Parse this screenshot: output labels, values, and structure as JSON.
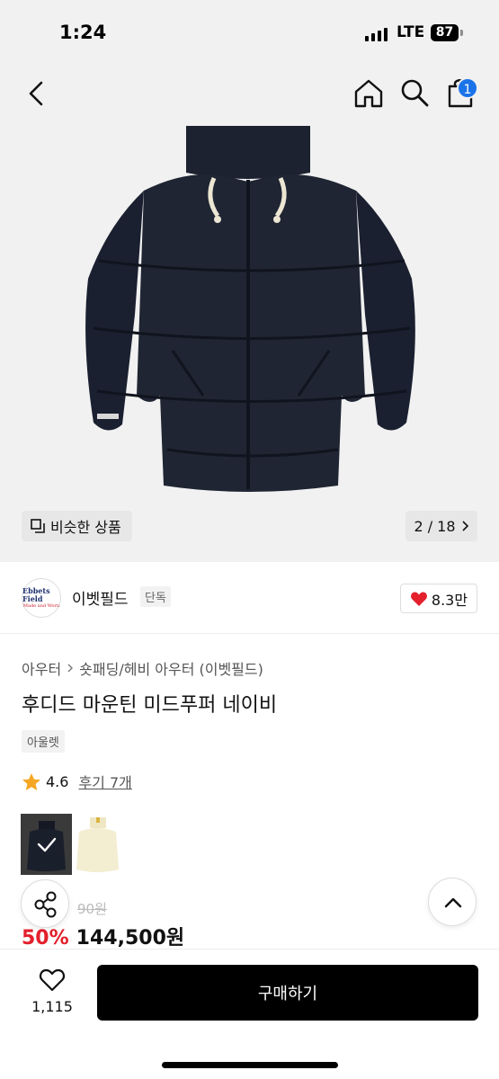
{
  "status_bar": {
    "time": "1:24",
    "network": "LTE",
    "battery": "87"
  },
  "nav": {
    "cart_badge": "1",
    "icons": [
      "back-icon",
      "home-icon",
      "search-icon",
      "shopping-bag-icon"
    ]
  },
  "gallery": {
    "similar_label": "비슷한 상품",
    "pager": "2 / 18"
  },
  "brand": {
    "logo_line1": "Ebbets Field",
    "logo_line2": "Made and Worn",
    "name": "이벳필드",
    "exclusive_tag": "단독",
    "likes": "8.3만"
  },
  "product": {
    "breadcrumb": [
      "아우터",
      "숏패딩/헤비 아우터 (이벳필드)"
    ],
    "title": "후디드 마운틴 미드푸퍼 네이비",
    "tag": "아울렛",
    "rating": "4.6",
    "reviews": "후기 7개",
    "original_price": "90원",
    "discount": "50%",
    "price": "144,500원"
  },
  "colors": {
    "accent_red": "#e3202c",
    "badge_blue": "#1a73e8",
    "jacket_navy": "#1d2230"
  },
  "bottom_bar": {
    "wish_count": "1,115",
    "buy_label": "구매하기"
  }
}
